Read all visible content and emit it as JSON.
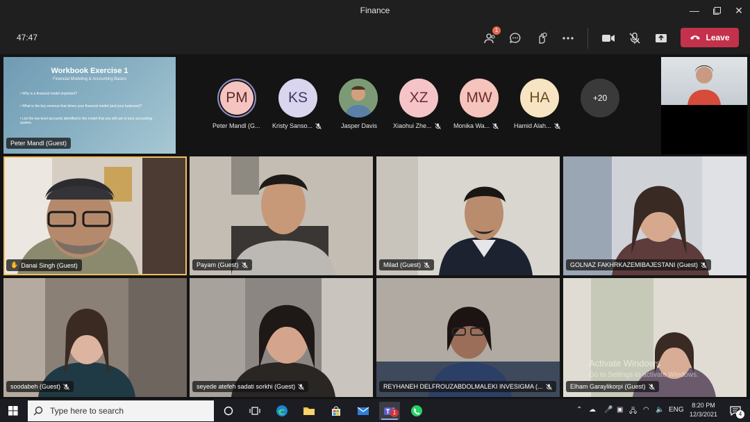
{
  "window": {
    "title": "Finance"
  },
  "toolbar": {
    "timer": "47:47",
    "participants_badge": "1",
    "leave_label": "Leave"
  },
  "share": {
    "title": "Workbook Exercise 1",
    "subtitle": "Financial Modeling & Accounting Basics",
    "bullets": [
      "Why is a financial model important?",
      "What is the key revenue that drives your financial model (and your business)?",
      "List the low level accounts identified in the model that you will use in your accounting system."
    ],
    "presenter": "Peter Mandl (Guest)"
  },
  "avatars": [
    {
      "initials": "PM",
      "name": "Peter Mandl (G...",
      "color": "#f5c4c0"
    },
    {
      "initials": "KS",
      "name": "Kristy Sanso...",
      "color": "#d9d5ef"
    },
    {
      "initials": "",
      "name": "Jasper Davis",
      "color": "#6f8f6a"
    },
    {
      "initials": "XZ",
      "name": "Xiaohui Zhe...",
      "color": "#f5c4c8"
    },
    {
      "initials": "MW",
      "name": "Monika Wa...",
      "color": "#f5c4bc"
    },
    {
      "initials": "HA",
      "name": "Hamid Alah...",
      "color": "#f6e4c2"
    }
  ],
  "overflow": "+20",
  "tiles": [
    {
      "name": "Danai Singh (Guest)"
    },
    {
      "name": "Payam (Guest)"
    },
    {
      "name": "Milad (Guest)"
    },
    {
      "name": "GOLNAZ FAKHRKAZEMIBAJESTANI (Guest)"
    },
    {
      "name": "soodabeh (Guest)"
    },
    {
      "name": "seyede atefeh sadati sorkhi (Guest)"
    },
    {
      "name": "REYHANEH DELFROUZABDOLMALEKI INVESIGMA (..."
    },
    {
      "name": "Elham Garaylikorpi (Guest)"
    }
  ],
  "activation": {
    "line1": "Activate Windows",
    "line2": "Go to Settings to activate Windows."
  },
  "taskbar": {
    "search_placeholder": "Type here to search",
    "teams_badge": "1",
    "language": "ENG",
    "time": "8:20 PM",
    "date": "12/3/2021",
    "notif_count": "4"
  }
}
